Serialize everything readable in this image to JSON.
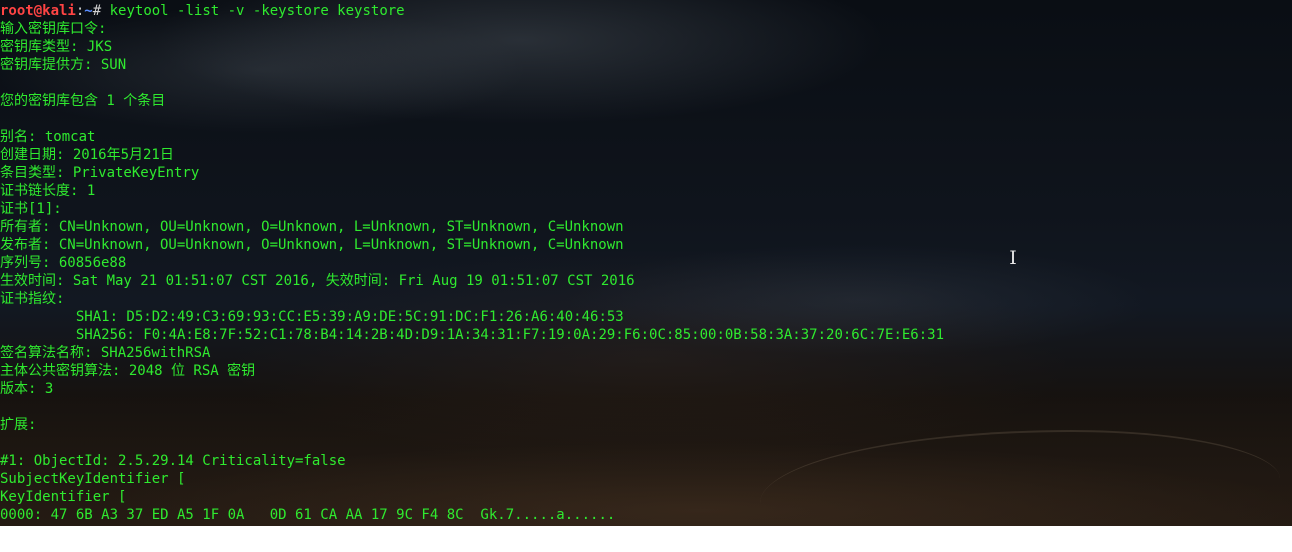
{
  "prompt": {
    "user_host": "root@kali",
    "sep": ":",
    "path": "~",
    "symbol": "#",
    "command": " keytool -list -v -keystore keystore"
  },
  "lines": [
    "输入密钥库口令:",
    "密钥库类型: JKS",
    "密钥库提供方: SUN",
    "",
    "您的密钥库包含 1 个条目",
    "",
    "别名: tomcat",
    "创建日期: 2016年5月21日",
    "条目类型: PrivateKeyEntry",
    "证书链长度: 1",
    "证书[1]:",
    "所有者: CN=Unknown, OU=Unknown, O=Unknown, L=Unknown, ST=Unknown, C=Unknown",
    "发布者: CN=Unknown, OU=Unknown, O=Unknown, L=Unknown, ST=Unknown, C=Unknown",
    "序列号: 60856e88",
    "生效时间: Sat May 21 01:51:07 CST 2016, 失效时间: Fri Aug 19 01:51:07 CST 2016",
    "证书指纹:",
    "         SHA1: D5:D2:49:C3:69:93:CC:E5:39:A9:DE:5C:91:DC:F1:26:A6:40:46:53",
    "         SHA256: F0:4A:E8:7F:52:C1:78:B4:14:2B:4D:D9:1A:34:31:F7:19:0A:29:F6:0C:85:00:0B:58:3A:37:20:6C:7E:E6:31",
    "签名算法名称: SHA256withRSA",
    "主体公共密钥算法: 2048 位 RSA 密钥",
    "版本: 3",
    "",
    "扩展:",
    "",
    "#1: ObjectId: 2.5.29.14 Criticality=false",
    "SubjectKeyIdentifier [",
    "KeyIdentifier [",
    "0000: 47 6B A3 37 ED A5 1F 0A   0D 61 CA AA 17 9C F4 8C  Gk.7.....a......"
  ],
  "cursor_glyph": "I"
}
